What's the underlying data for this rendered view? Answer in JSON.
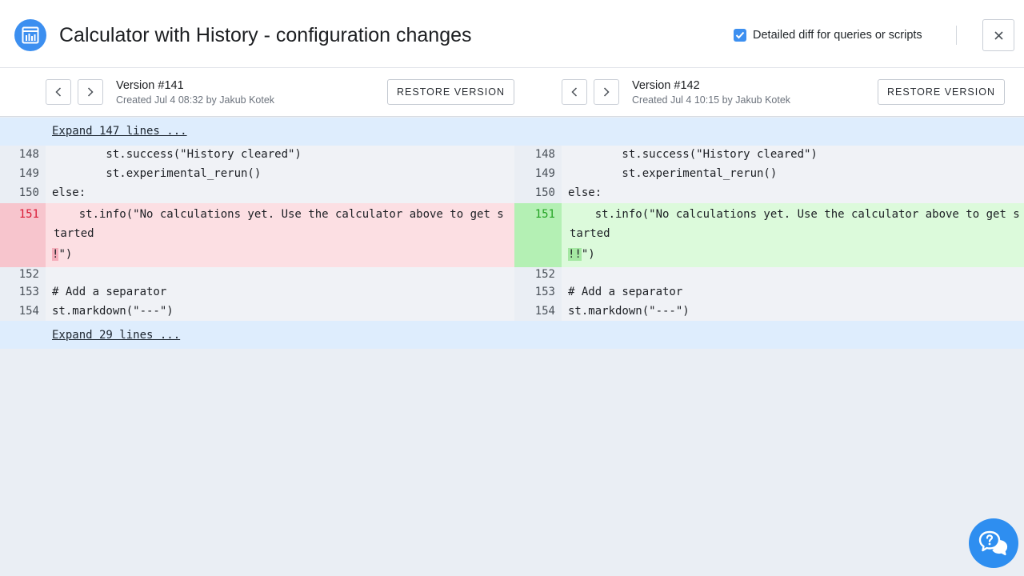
{
  "header": {
    "title": "Calculator with History - configuration changes",
    "detailed_diff_label": "Detailed diff for queries or scripts",
    "detailed_diff_checked": true,
    "app_icon": "chart-icon",
    "close_icon": "close-icon"
  },
  "left_version": {
    "title": "Version #141",
    "subtitle": "Created Jul 4 08:32 by Jakub Kotek",
    "restore_label": "RESTORE VERSION"
  },
  "right_version": {
    "title": "Version #142",
    "subtitle": "Created Jul 4 10:15 by Jakub Kotek",
    "restore_label": "RESTORE VERSION"
  },
  "expand_top": "Expand 147 lines ...",
  "expand_bottom": "Expand 29 lines ...",
  "lines": {
    "n148": "148",
    "n149": "149",
    "n150": "150",
    "n151": "151",
    "n152": "152",
    "n153": "153",
    "n154": "154",
    "l148": "        st.success(\"History cleared\")",
    "l149": "        st.experimental_rerun()",
    "l150": "else:",
    "l151a": "    st.info(\"No calculations yet. Use the calculator above to get s",
    "l151b": "tarted",
    "l152": "",
    "l153": "# Add a separator",
    "l154": "st.markdown(\"---\")"
  },
  "left_change": {
    "highlight": "!",
    "rest": "\")"
  },
  "right_change": {
    "highlight": "!!",
    "rest": "\")"
  },
  "colors": {
    "accent": "#3c8ff0",
    "deleted": "#fcdfe3",
    "added": "#dcfadb",
    "expand": "#deedfd"
  },
  "help_icon": "chat-help-icon"
}
